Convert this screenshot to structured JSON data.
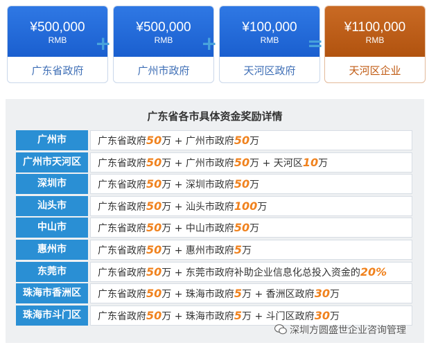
{
  "cards": [
    {
      "amount": "¥500,000",
      "currency": "RMB",
      "label": "广东省政府"
    },
    {
      "amount": "¥500,000",
      "currency": "RMB",
      "label": "广州市政府"
    },
    {
      "amount": "¥100,000",
      "currency": "RMB",
      "label": "天河区政府"
    },
    {
      "amount": "¥1100,000",
      "currency": "RMB",
      "label": "天河区企业"
    }
  ],
  "operators": {
    "plus": "+",
    "equals": "="
  },
  "table": {
    "title": "广东省各市具体资金奖励详情",
    "rows": [
      {
        "city": "广州市",
        "parts": [
          "广东省政府",
          "50",
          "万 + 广州市政府",
          "50",
          "万"
        ]
      },
      {
        "city": "广州市天河区",
        "parts": [
          "广东省政府",
          "50",
          "万 + 广州市政府",
          "50",
          "万 + 天河区",
          "10",
          "万"
        ]
      },
      {
        "city": "深圳市",
        "parts": [
          "广东省政府",
          "50",
          "万 + 深圳市政府",
          "50",
          "万"
        ]
      },
      {
        "city": "汕头市",
        "parts": [
          "广东省政府",
          "50",
          "万 + 汕头市政府",
          "100",
          "万"
        ]
      },
      {
        "city": "中山市",
        "parts": [
          "广东省政府",
          "50",
          "万 + 中山市政府",
          "50",
          "万"
        ]
      },
      {
        "city": "惠州市",
        "parts": [
          "广东省政府",
          "50",
          "万 + 惠州市政府",
          "5",
          "万"
        ]
      },
      {
        "city": "东莞市",
        "parts": [
          "广东省政府",
          "50",
          "万 + 东莞市政府补助企业信息化总投入资金的",
          "20%"
        ]
      },
      {
        "city": "珠海市香洲区",
        "parts": [
          "广东省政府",
          "50",
          "万 + 珠海市政府",
          "5",
          "万 + 香洲区政府",
          "30",
          "万"
        ]
      },
      {
        "city": "珠海市斗门区",
        "parts": [
          "广东省政府",
          "50",
          "万 + 珠海市政府",
          "5",
          "万 + 斗门区政府",
          "30",
          "万"
        ]
      }
    ]
  },
  "watermark": {
    "text": "深圳方圆盛世企业咨询管理",
    "icon": "wechat-icon"
  },
  "colors": {
    "blue": "#1f67d8",
    "orange": "#b9591a",
    "highlight": "#f0821e",
    "cityBlue": "#2a8fd4"
  }
}
